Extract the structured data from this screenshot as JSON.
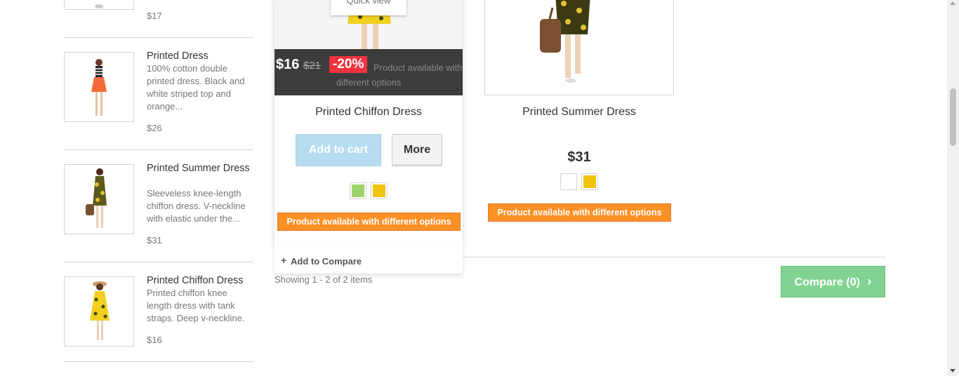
{
  "sidebar": {
    "items": [
      {
        "price": "$17"
      },
      {
        "title": "Printed Dress",
        "desc": "100% cotton double printed dress. Black and white striped top and orange...",
        "price": "$26"
      },
      {
        "title": "Printed Summer Dress",
        "desc": "Sleeveless knee-length chiffon dress. V-neckline with elastic under the...",
        "price": "$31"
      },
      {
        "title": "Printed Chiffon Dress",
        "desc": "Printed chiffon knee length dress with tank straps. Deep v-neckline.",
        "price": "$16"
      }
    ]
  },
  "product1": {
    "quick_view": "Quick view",
    "price": "$16",
    "old_price": "$21",
    "discount": "-20%",
    "overlay_note": "Product available with different options",
    "name": "Printed Chiffon Dress",
    "add_to_cart": "Add to cart",
    "more": "More",
    "swatches": [
      "#9ed36b",
      "#f1c40f"
    ],
    "availability": "Product available with different options",
    "add_to_compare": "Add to Compare"
  },
  "product2": {
    "name": "Printed Summer Dress",
    "price": "$31",
    "swatches": [
      "#ffffff",
      "#f1c40f"
    ],
    "availability": "Product available with different options"
  },
  "listing": {
    "showing": "Showing 1 - 2 of 2 items",
    "compare_button": "Compare (0)"
  },
  "colors": {
    "accent_orange": "#fe9126",
    "discount_red": "#f13340",
    "compare_green": "#82d392"
  }
}
